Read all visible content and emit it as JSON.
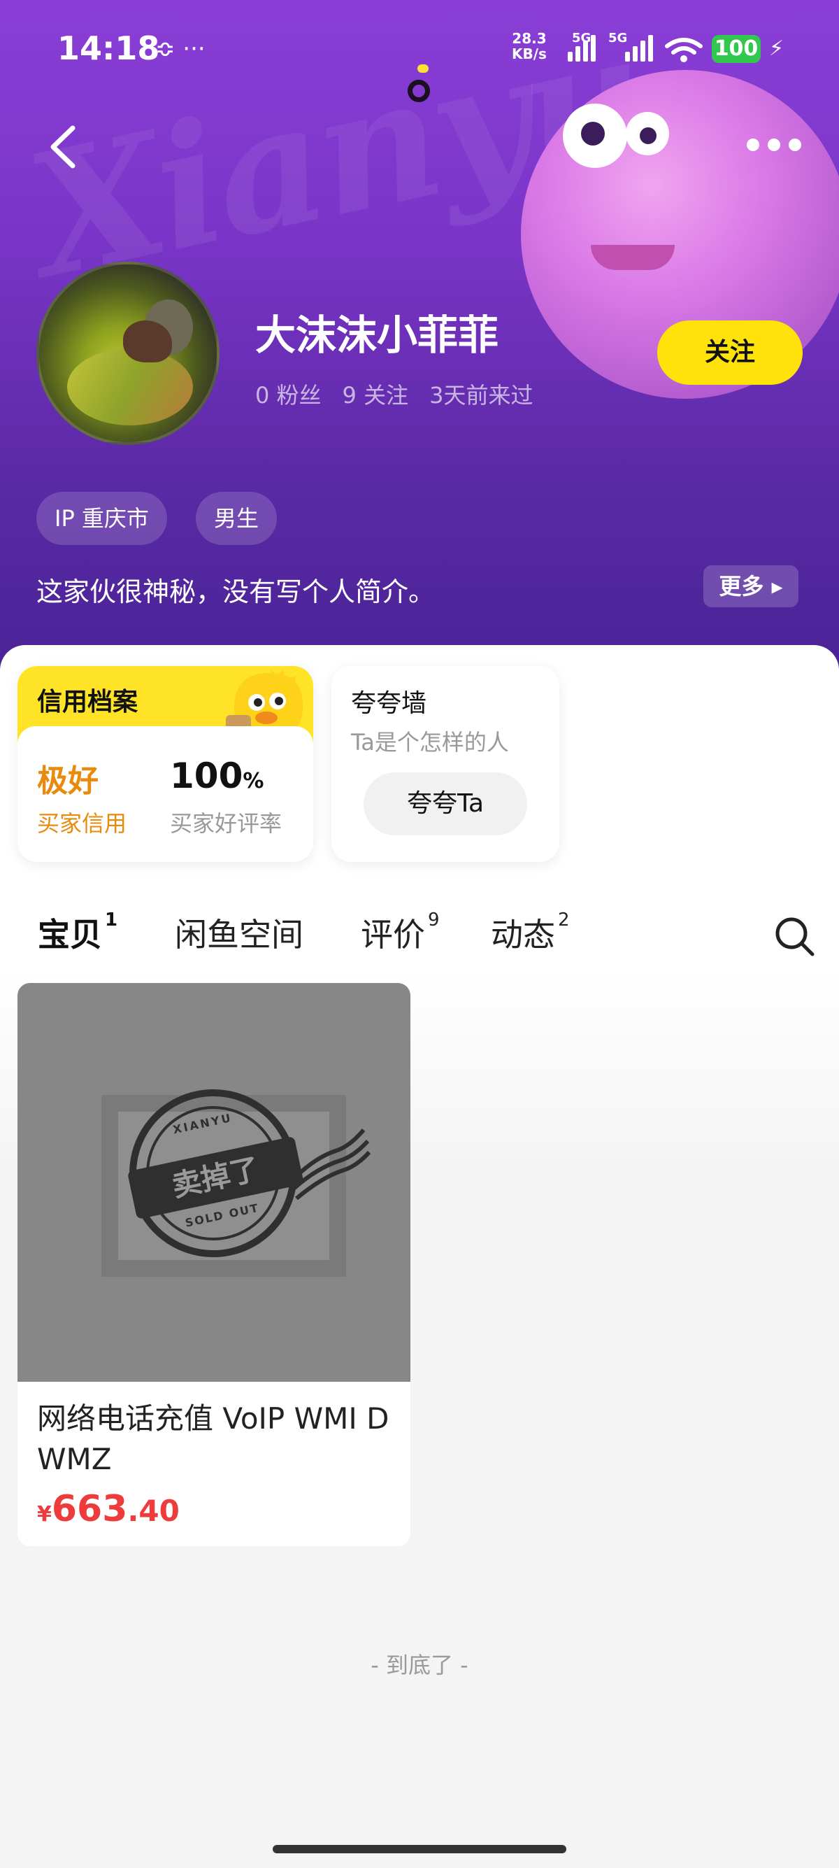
{
  "status_bar": {
    "time": "14:18",
    "left_icons": "≎ ···",
    "net_speed_value": "28.3",
    "net_speed_unit": "KB/s",
    "sig1_label": "5G",
    "sig2_label": "5G",
    "battery": "100"
  },
  "header": {
    "watermark": "Xianyu",
    "more_icon": "more-dots-icon",
    "back_icon": "chevron-left-icon"
  },
  "profile": {
    "name": "大沫沫小菲菲",
    "stats": [
      "0 粉丝",
      "9 关注",
      "3天前来过"
    ],
    "follow_label": "关注",
    "tags": [
      "IP 重庆市",
      "男生"
    ],
    "bio": "这家伙很神秘，没有写个人简介。",
    "bio_more": "更多"
  },
  "credit": {
    "title": "信用档案",
    "buyer_credit_value": "极好",
    "buyer_credit_label": "买家信用",
    "good_rate_value": "100",
    "good_rate_unit": "%",
    "good_rate_label": "买家好评率"
  },
  "praise": {
    "title": "夸夸墙",
    "subtitle": "Ta是个怎样的人",
    "button": "夸夸Ta"
  },
  "tabs": [
    {
      "label": "宝贝",
      "count": "1"
    },
    {
      "label": "闲鱼空间",
      "count": ""
    },
    {
      "label": "评价",
      "count": "9"
    },
    {
      "label": "动态",
      "count": "2"
    }
  ],
  "product": {
    "stamp_main": "卖掉了",
    "stamp_top": "XIANYU",
    "stamp_bottom": "SOLD OUT",
    "title": "网络电话充值 VoIP WMI D WMZ",
    "price_symbol": "¥",
    "price_int": "663",
    "price_dec": ".40"
  },
  "footer": {
    "end_text": "- 到底了 -"
  },
  "colors": {
    "accent_yellow": "#ffe20a",
    "header_purple": "#7a35c8",
    "price_red": "#ee3b3b",
    "credit_orange": "#e88a0c"
  }
}
